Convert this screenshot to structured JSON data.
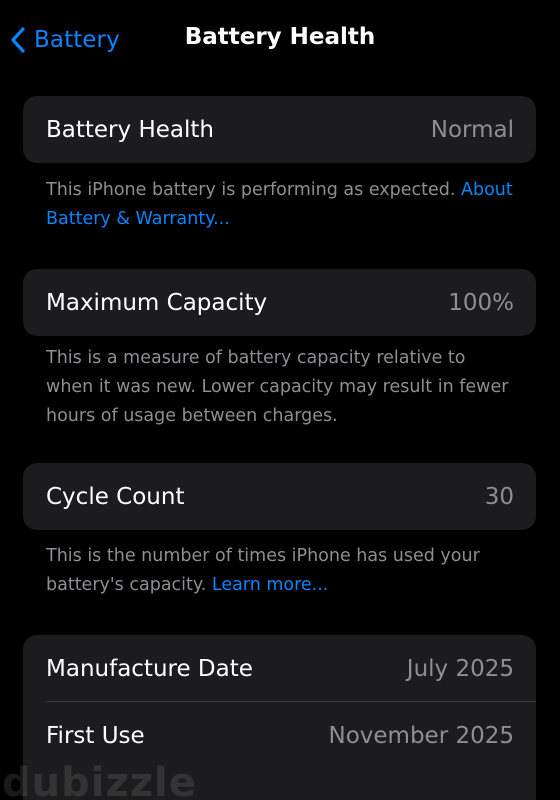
{
  "nav": {
    "back_label": "Battery",
    "title": "Battery Health"
  },
  "battery_health": {
    "label": "Battery Health",
    "value": "Normal",
    "footnote": "This iPhone battery is performing as expected. ",
    "footnote_link": "About Battery & Warranty..."
  },
  "maximum_capacity": {
    "label": "Maximum Capacity",
    "value": "100%",
    "footnote": "This is a measure of battery capacity relative to when it was new. Lower capacity may result in fewer hours of usage between charges."
  },
  "cycle_count": {
    "label": "Cycle Count",
    "value": "30",
    "footnote": "This is the number of times iPhone has used your battery's capacity. ",
    "footnote_link": "Learn more..."
  },
  "dates": {
    "manufacture_label": "Manufacture Date",
    "manufacture_value": "July 2025",
    "first_use_label": "First Use",
    "first_use_value": "November 2025"
  },
  "watermark": "dubizzle",
  "colors": {
    "background": "#000000",
    "card": "#1c1c1e",
    "accent": "#0a84ff",
    "secondary_text": "#8e8e93"
  }
}
